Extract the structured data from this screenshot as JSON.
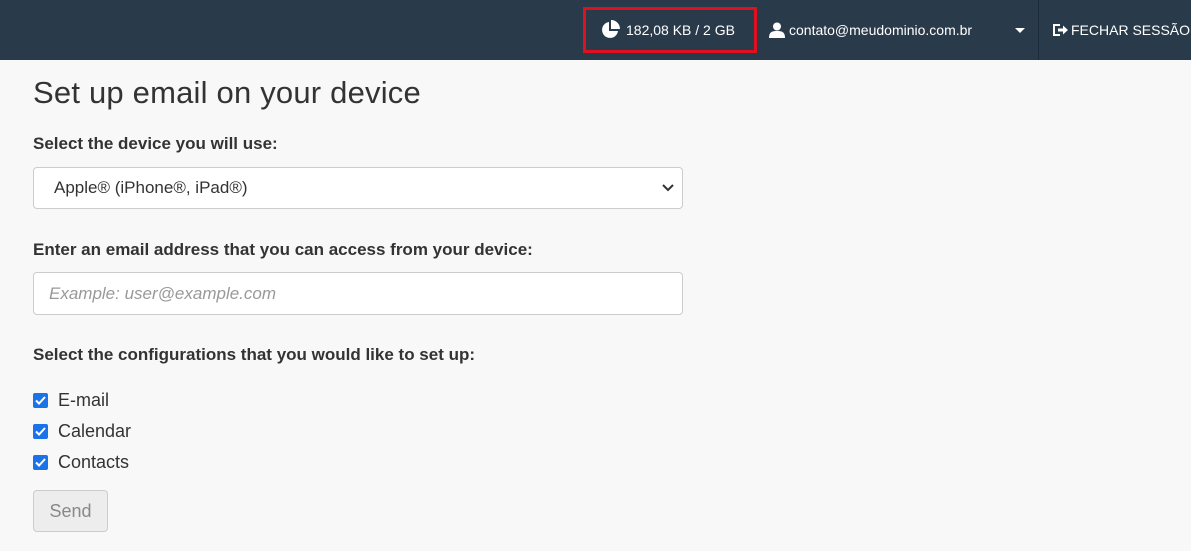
{
  "topbar": {
    "quota_text": "182,08 KB / 2 GB",
    "quota_icon": "pie-chart-icon",
    "user_email": "contato@meudominio.com.br",
    "user_icon": "user-icon",
    "dropdown_icon": "caret-down-icon",
    "logout_label": "FECHAR SESSÃO",
    "logout_icon": "sign-out-icon",
    "highlight_color": "#e0101e",
    "bar_color": "#293a4a"
  },
  "page": {
    "title": "Set up email on your device",
    "device_label": "Select the device you will use:",
    "device_selected": "Apple® (iPhone®, iPad®)",
    "email_label": "Enter an email address that you can access from your device:",
    "email_placeholder": "Example: user@example.com",
    "email_value": "",
    "config_label": "Select the configurations that you would like to set up:",
    "configs": [
      {
        "label": "E-mail",
        "checked": true
      },
      {
        "label": "Calendar",
        "checked": true
      },
      {
        "label": "Contacts",
        "checked": true
      }
    ],
    "send_label": "Send",
    "checkbox_color": "#1a73e8"
  }
}
